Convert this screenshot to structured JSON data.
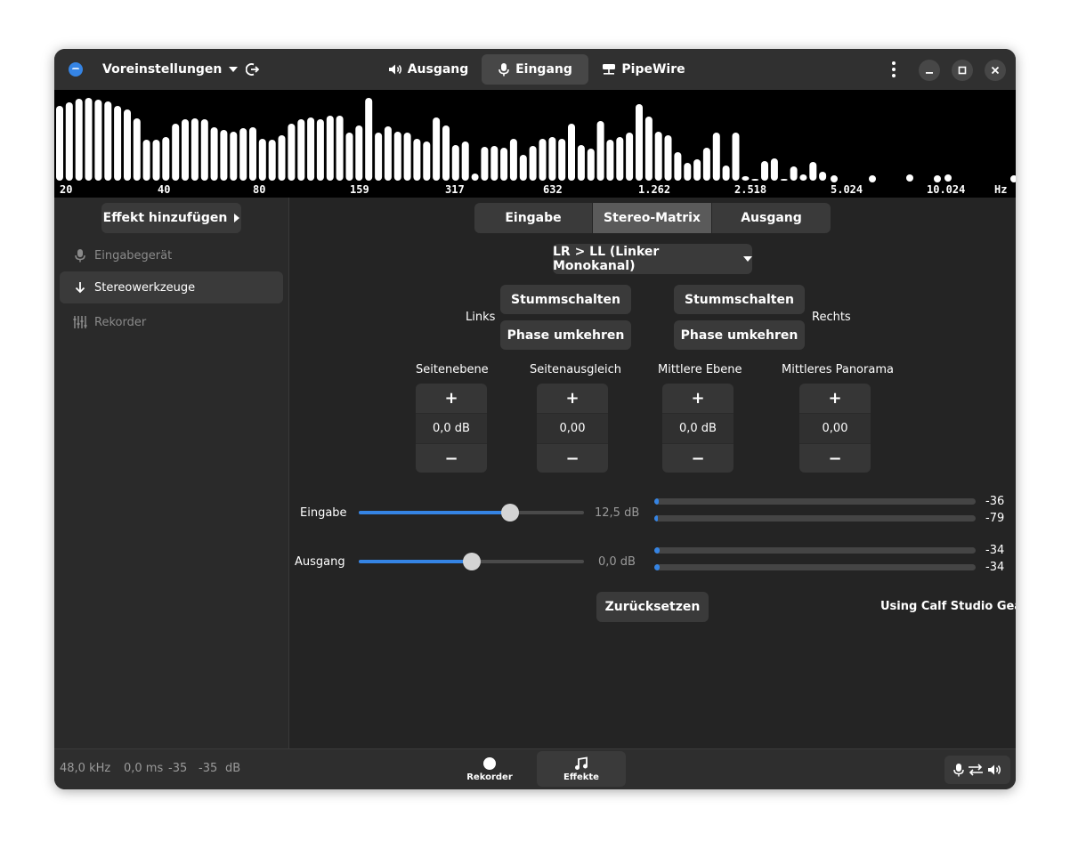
{
  "header": {
    "presets_label": "Voreinstellungen",
    "tabs": [
      {
        "label": "Ausgang",
        "icon": "speaker-icon"
      },
      {
        "label": "Eingang",
        "icon": "microphone-icon",
        "selected": true
      },
      {
        "label": "PipeWire",
        "icon": "network-icon"
      }
    ]
  },
  "spectrum": {
    "freq_labels": [
      "20",
      "40",
      "80",
      "159",
      "317",
      "632",
      "1.262",
      "2.518",
      "5.024",
      "10.024",
      "Hz"
    ],
    "bar_color": "#ffffff",
    "levels": [
      0.84,
      0.88,
      0.92,
      0.93,
      0.91,
      0.89,
      0.84,
      0.8,
      0.7,
      0.46,
      0.46,
      0.49,
      0.64,
      0.69,
      0.7,
      0.69,
      0.6,
      0.57,
      0.55,
      0.59,
      0.6,
      0.47,
      0.46,
      0.51,
      0.64,
      0.69,
      0.71,
      0.69,
      0.73,
      0.73,
      0.54,
      0.62,
      0.93,
      0.54,
      0.61,
      0.55,
      0.54,
      0.47,
      0.44,
      0.71,
      0.62,
      0.4,
      0.44,
      0.08,
      0.38,
      0.39,
      0.37,
      0.47,
      0.29,
      0.39,
      0.47,
      0.49,
      0.47,
      0.64,
      0.4,
      0.36,
      0.67,
      0.46,
      0.49,
      0.54,
      0.86,
      0.72,
      0.55,
      0.51,
      0.32,
      0.2,
      0.24,
      0.37,
      0.54,
      0.17,
      0.54,
      0.05,
      0.02,
      0.22,
      0.25,
      0.02,
      0.16,
      0.07,
      0.21,
      0.1,
      0.0,
      0.0,
      0.0,
      0.0,
      0.0,
      0.0,
      0.0,
      0.0,
      0.0,
      0.0,
      0.0,
      0.0,
      0.0,
      0.0,
      0.0,
      0.0,
      0.0,
      0.0,
      0.0,
      0.0,
      0.0,
      0.0,
      0.0,
      0.0,
      0.0,
      0.0,
      0.0,
      0.0,
      0.0,
      0.0
    ]
  },
  "sidebar": {
    "add_effect_label": "Effekt hinzufügen",
    "items": [
      {
        "label": "Eingabegerät",
        "icon": "microphone-icon"
      },
      {
        "label": "Stereowerkzeuge",
        "icon": "arrow-down-icon",
        "selected": true
      },
      {
        "label": "Rekorder",
        "icon": "equalizer-icon"
      }
    ]
  },
  "main": {
    "tabs": [
      "Eingabe",
      "Stereo-Matrix",
      "Ausgang"
    ],
    "selected_tab": "Stereo-Matrix",
    "mode_dropdown": "LR > LL (Linker Monokanal)",
    "left_label": "Links",
    "right_label": "Rechts",
    "mute_label": "Stummschalten",
    "invert_phase_label": "Phase umkehren",
    "spinners": [
      {
        "label": "Seitenebene",
        "value": "0,0 dB",
        "plus": "+",
        "minus": "−"
      },
      {
        "label": "Seitenausgleich",
        "value": "0,00",
        "plus": "+",
        "minus": "−"
      },
      {
        "label": "Mittlere Ebene",
        "value": "0,0 dB",
        "plus": "+",
        "minus": "−"
      },
      {
        "label": "Mittleres Panorama",
        "value": "0,00",
        "plus": "+",
        "minus": "−"
      }
    ],
    "input_gain": {
      "label": "Eingabe",
      "value": "12,5 dB",
      "position": 0.67
    },
    "output_gain": {
      "label": "Ausgang",
      "value": "0,0 dB",
      "position": 0.5
    },
    "input_levels": [
      {
        "value": "-36",
        "fill": 0.014
      },
      {
        "value": "-79",
        "fill": 0.0
      }
    ],
    "output_levels": [
      {
        "value": "-34",
        "fill": 0.018
      },
      {
        "value": "-34",
        "fill": 0.018
      }
    ],
    "reset_label": "Zurücksetzen",
    "plugin_credit": "Using Calf Studio Gear"
  },
  "bottom": {
    "sample_rate": "48,0 kHz",
    "latency": "0,0 ms",
    "level_left": "-35",
    "level_right": "-35",
    "level_unit": "dB",
    "views": [
      {
        "label": "Rekorder",
        "icon": "record-icon"
      },
      {
        "label": "Effekte",
        "icon": "music-note-icon",
        "selected": true
      }
    ]
  },
  "colors": {
    "accent": "#3584e4",
    "window_bg": "#242424",
    "header_bg": "#303030"
  }
}
